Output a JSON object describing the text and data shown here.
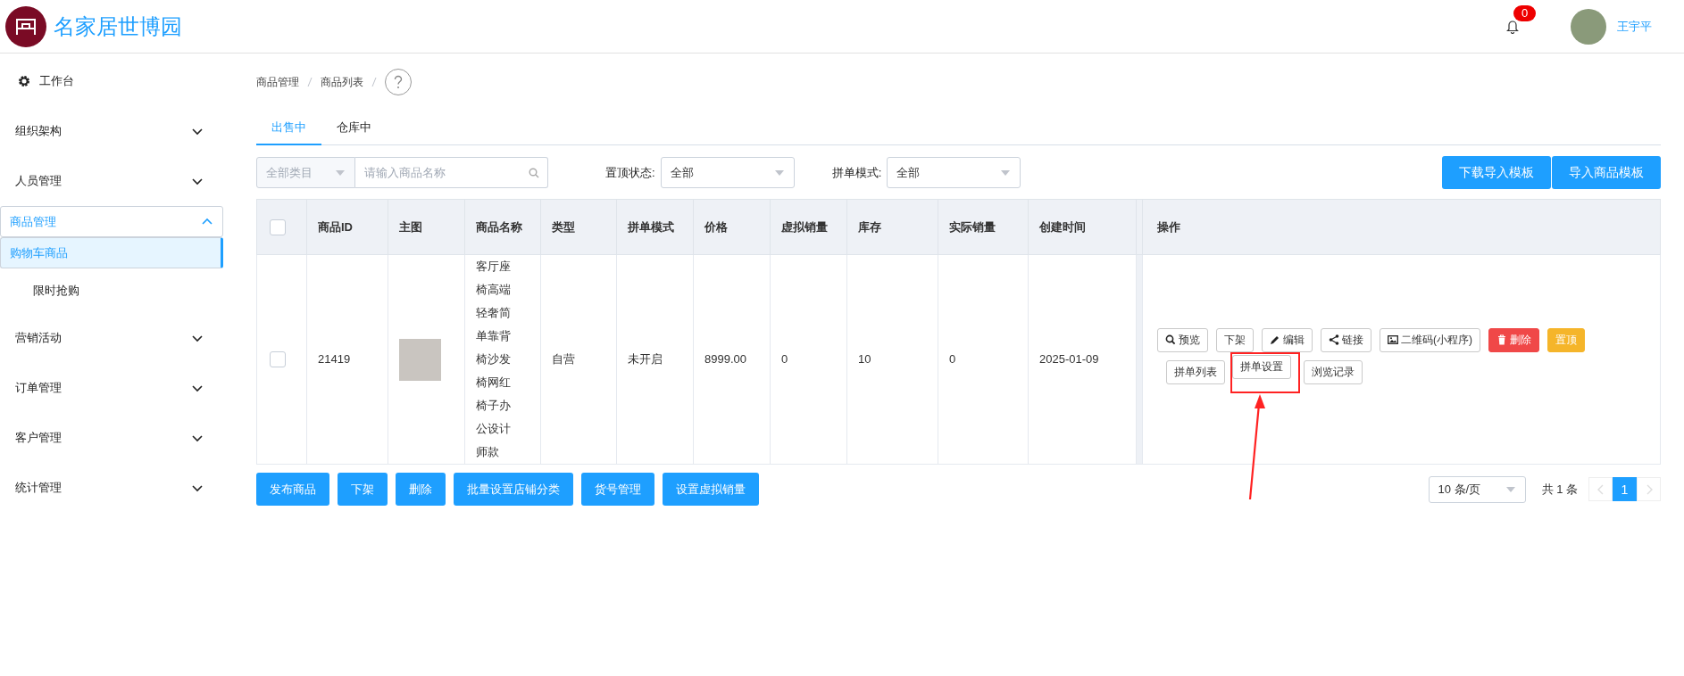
{
  "header": {
    "logo_text": "名家居世博园",
    "notification_count": "0",
    "user_name": "王宇平"
  },
  "sidebar": {
    "dashboard": {
      "label": "工作台"
    },
    "menus": [
      {
        "label": "组织架构",
        "expanded": false,
        "selected": false
      },
      {
        "label": "人员管理",
        "expanded": false,
        "selected": false
      },
      {
        "label": "商品管理",
        "expanded": true,
        "selected": true,
        "children": [
          {
            "label": "购物车商品",
            "selected": true
          },
          {
            "label": "限时抢购",
            "selected": false
          }
        ]
      },
      {
        "label": "营销活动",
        "expanded": false,
        "selected": false
      },
      {
        "label": "订单管理",
        "expanded": false,
        "selected": false
      },
      {
        "label": "客户管理",
        "expanded": false,
        "selected": false
      },
      {
        "label": "统计管理",
        "expanded": false,
        "selected": false
      }
    ]
  },
  "breadcrumb": [
    "商品管理",
    "商品列表"
  ],
  "tabs": [
    {
      "label": "出售中",
      "selected": true
    },
    {
      "label": "仓库中",
      "selected": false
    }
  ],
  "filters": {
    "category": "全部类目",
    "search_placeholder": "请输入商品名称",
    "pin_status": {
      "label": "置顶状态:",
      "value": "全部"
    },
    "group_mode": {
      "label": "拼单模式:",
      "value": "全部"
    }
  },
  "toolbar_buttons": [
    "下载导入模板",
    "导入商品模板"
  ],
  "table": {
    "select_all_checked": false,
    "columns": [
      "商品ID",
      "主图",
      "商品名称",
      "类型",
      "拼单模式",
      "价格",
      "虚拟销量",
      "库存",
      "实际销量",
      "创建时间",
      "操作"
    ],
    "rows": [
      {
        "checked": false,
        "id": "21419",
        "name": "客厅座椅高端轻奢简单靠背椅沙发椅网红椅子办公设计师款",
        "type": "自营",
        "group_mode": "未开启",
        "price": "8999.00",
        "virtual_sales": "0",
        "stock": "10",
        "actual_sales": "0",
        "created": "2025-01-09",
        "actions": [
          {
            "label": "预览",
            "kind": "default",
            "highlighted": false
          },
          {
            "label": "下架",
            "kind": "default",
            "highlighted": false
          },
          {
            "label": "编辑",
            "kind": "default",
            "highlighted": false
          },
          {
            "label": "链接",
            "kind": "default",
            "highlighted": false
          },
          {
            "label": "二维码(小程序)",
            "kind": "default",
            "highlighted": false
          },
          {
            "label": "删除",
            "kind": "danger",
            "highlighted": false
          },
          {
            "label": "置顶",
            "kind": "warning",
            "highlighted": false
          },
          {
            "label": "拼单列表",
            "kind": "default",
            "highlighted": false
          },
          {
            "label": "拼单设置",
            "kind": "default",
            "highlighted": true
          },
          {
            "label": "浏览记录",
            "kind": "default",
            "highlighted": false
          }
        ]
      }
    ]
  },
  "bottom_buttons": [
    "发布商品",
    "下架",
    "删除",
    "批量设置店铺分类",
    "货号管理",
    "设置虚拟销量"
  ],
  "pagination": {
    "page_size": "10 条/页",
    "total": "共 1 条",
    "pages": [
      {
        "label": "1",
        "selected": true
      }
    ]
  }
}
